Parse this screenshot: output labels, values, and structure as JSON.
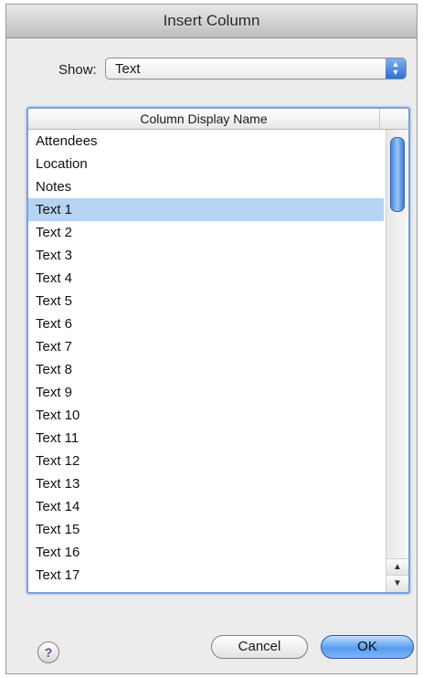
{
  "window": {
    "title": "Insert Column"
  },
  "show": {
    "label": "Show:",
    "value": "Text"
  },
  "list": {
    "header": "Column Display Name",
    "selected_index": 3,
    "items": [
      "Attendees",
      "Location",
      "Notes",
      "Text 1",
      "Text 2",
      "Text 3",
      "Text 4",
      "Text 5",
      "Text 6",
      "Text 7",
      "Text 8",
      "Text 9",
      "Text 10",
      "Text 11",
      "Text 12",
      "Text 13",
      "Text 14",
      "Text 15",
      "Text 16",
      "Text 17"
    ]
  },
  "buttons": {
    "cancel": "Cancel",
    "ok": "OK",
    "help": "?"
  },
  "icons": {
    "help": "help-icon",
    "popup": "up-down-arrows-icon",
    "scroll_up": "up-arrow-icon",
    "scroll_down": "down-arrow-icon"
  },
  "colors": {
    "selection": "#b5d3f3",
    "accent": "#5a9bef"
  }
}
